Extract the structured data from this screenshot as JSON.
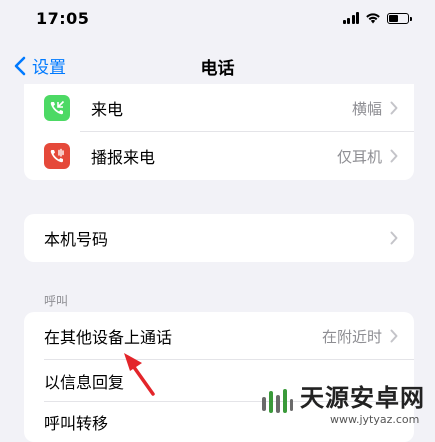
{
  "status_bar": {
    "time": "17:05"
  },
  "nav": {
    "back_label": "设置",
    "title": "电话"
  },
  "group1": [
    {
      "label": "来电",
      "value": "横幅",
      "icon": "incoming-call-icon",
      "color": "#4cd964"
    },
    {
      "label": "播报来电",
      "value": "仅耳机",
      "icon": "announce-call-icon",
      "color": "#e5493a"
    }
  ],
  "group2": {
    "label": "本机号码"
  },
  "section_header": "呼叫",
  "group3": [
    {
      "label": "在其他设备上通话",
      "value": "在附近时"
    },
    {
      "label": "以信息回复"
    },
    {
      "label": "呼叫转移"
    }
  ],
  "watermark": {
    "name": "天源安卓网",
    "url": "www.jytyaz.com"
  },
  "colors": {
    "accent": "#007aff",
    "background": "#f2f2f7",
    "arrow": "#e3252a"
  }
}
